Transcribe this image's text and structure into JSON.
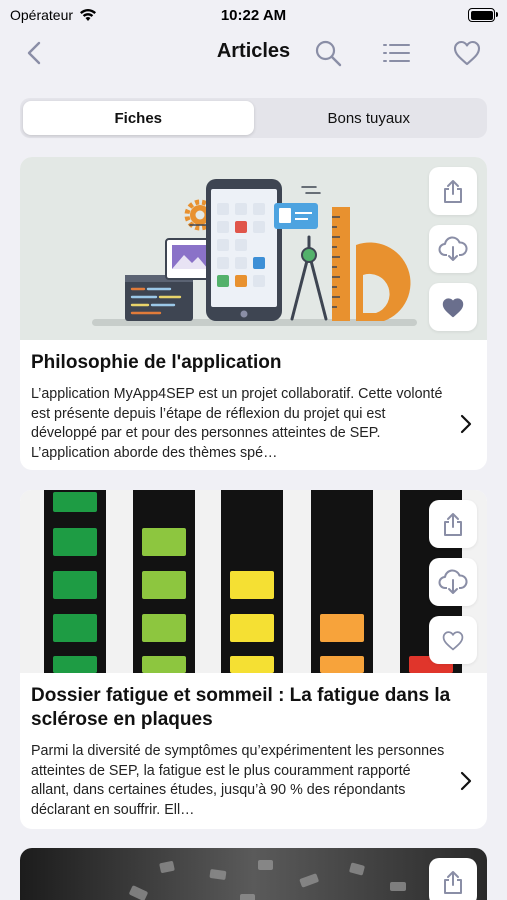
{
  "status_bar": {
    "carrier": "Opérateur",
    "time": "10:22 AM"
  },
  "nav": {
    "title": "Articles"
  },
  "segments": [
    {
      "label": "Fiches",
      "active": true
    },
    {
      "label": "Bons tuyaux",
      "active": false
    }
  ],
  "articles": [
    {
      "title": "Philosophie de l'application",
      "excerpt": "L’application MyApp4SEP est un projet collaboratif. Cette volonté est présente depuis l’étape de réflexion du projet qui est développé par et pour des personnes atteintes de SEP. L’application aborde des thèmes spé…",
      "favorite": true
    },
    {
      "title": "Dossier fatigue et sommeil : La fatigue dans la sclérose en plaques",
      "excerpt": "Parmi la diversité de symptômes qu’expérimentent les personnes atteintes de SEP, la fatigue est le plus couramment rapporté allant, dans certaines études, jusqu’à 90 % des répondants déclarant en souffrir. Ell…",
      "favorite": false
    }
  ],
  "icons": {
    "share": "share-icon",
    "download": "cloud-download-icon",
    "favorite": "heart-icon",
    "back": "chevron-left-icon",
    "search": "search-icon",
    "list": "list-icon"
  },
  "colors": {
    "accent": "#8a8ea6",
    "background": "#f0f0f5",
    "favorite_fill": "#6a6f8d"
  }
}
